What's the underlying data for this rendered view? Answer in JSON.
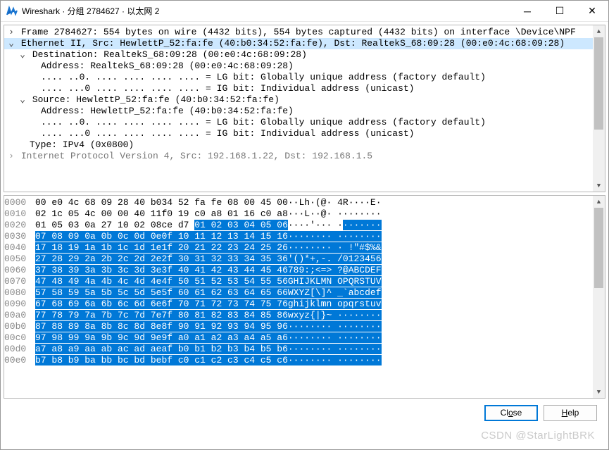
{
  "title": "Wireshark · 分组 2784627 · 以太网 2",
  "buttons": {
    "close": "Close",
    "help": "Help"
  },
  "watermark": "CSDN @StarLightBRK",
  "tree": {
    "frame": "Frame 2784627: 554 bytes on wire (4432 bits), 554 bytes captured (4432 bits) on interface \\Device\\NPF",
    "eth": "Ethernet II, Src: HewlettP_52:fa:fe (40:b0:34:52:fa:fe), Dst: RealtekS_68:09:28 (00:e0:4c:68:09:28)",
    "dest": "Destination: RealtekS_68:09:28 (00:e0:4c:68:09:28)",
    "dest_addr": "Address: RealtekS_68:09:28 (00:e0:4c:68:09:28)",
    "dest_lg": ".... ..0. .... .... .... .... = LG bit: Globally unique address (factory default)",
    "dest_ig": ".... ...0 .... .... .... .... = IG bit: Individual address (unicast)",
    "src": "Source: HewlettP_52:fa:fe (40:b0:34:52:fa:fe)",
    "src_addr": "Address: HewlettP_52:fa:fe (40:b0:34:52:fa:fe)",
    "src_lg": ".... ..0. .... .... .... .... = LG bit: Globally unique address (factory default)",
    "src_ig": ".... ...0 .... .... .... .... = IG bit: Individual address (unicast)",
    "type": "Type: IPv4 (0x0800)",
    "ip": "Internet Protocol Version 4, Src: 192.168.1.22, Dst: 192.168.1.5"
  },
  "hex": {
    "rows": [
      {
        "off": "0000",
        "h1": "00 e0 4c 68 09 28 40 b0",
        "h2": "34 52 fa fe 08 00 45 00",
        "a": "··Lh·(@· 4R····E·",
        "s1": 0,
        "s2": 0
      },
      {
        "off": "0010",
        "h1": "02 1c 05 4c 00 00 40 11",
        "h2": "f0 19 c0 a8 01 16 c0 a8",
        "a": "···L··@· ········",
        "s1": 0,
        "s2": 0
      },
      {
        "off": "0020",
        "h1": "01 05 03 0a 27 10 02 08",
        "h2": "ce d7 01 02 03 04 05 06",
        "a": "····'··· ········",
        "s1": 0,
        "s2": 30,
        "as": 10
      },
      {
        "off": "0030",
        "h1": "07 08 09 0a 0b 0c 0d 0e",
        "h2": "0f 10 11 12 13 14 15 16",
        "a": "········ ········",
        "s1": 1,
        "s2": 1,
        "as": 0
      },
      {
        "off": "0040",
        "h1": "17 18 19 1a 1b 1c 1d 1e",
        "h2": "1f 20 21 22 23 24 25 26",
        "a": "········ · !\"#$%&",
        "s1": 1,
        "s2": 1,
        "as": 0
      },
      {
        "off": "0050",
        "h1": "27 28 29 2a 2b 2c 2d 2e",
        "h2": "2f 30 31 32 33 34 35 36",
        "a": "'()*+,-. /0123456",
        "s1": 1,
        "s2": 1,
        "as": 0
      },
      {
        "off": "0060",
        "h1": "37 38 39 3a 3b 3c 3d 3e",
        "h2": "3f 40 41 42 43 44 45 46",
        "a": "789:;<=> ?@ABCDEF",
        "s1": 1,
        "s2": 1,
        "as": 0
      },
      {
        "off": "0070",
        "h1": "47 48 49 4a 4b 4c 4d 4e",
        "h2": "4f 50 51 52 53 54 55 56",
        "a": "GHIJKLMN OPQRSTUV",
        "s1": 1,
        "s2": 1,
        "as": 0
      },
      {
        "off": "0080",
        "h1": "57 58 59 5a 5b 5c 5d 5e",
        "h2": "5f 60 61 62 63 64 65 66",
        "a": "WXYZ[\\]^ _`abcdef",
        "s1": 1,
        "s2": 1,
        "as": 0
      },
      {
        "off": "0090",
        "h1": "67 68 69 6a 6b 6c 6d 6e",
        "h2": "6f 70 71 72 73 74 75 76",
        "a": "ghijklmn opqrstuv",
        "s1": 1,
        "s2": 1,
        "as": 0
      },
      {
        "off": "00a0",
        "h1": "77 78 79 7a 7b 7c 7d 7e",
        "h2": "7f 80 81 82 83 84 85 86",
        "a": "wxyz{|}~ ········",
        "s1": 1,
        "s2": 1,
        "as": 0
      },
      {
        "off": "00b0",
        "h1": "87 88 89 8a 8b 8c 8d 8e",
        "h2": "8f 90 91 92 93 94 95 96",
        "a": "········ ········",
        "s1": 1,
        "s2": 1,
        "as": 0
      },
      {
        "off": "00c0",
        "h1": "97 98 99 9a 9b 9c 9d 9e",
        "h2": "9f a0 a1 a2 a3 a4 a5 a6",
        "a": "········ ········",
        "s1": 1,
        "s2": 1,
        "as": 0
      },
      {
        "off": "00d0",
        "h1": "a7 a8 a9 aa ab ac ad ae",
        "h2": "af b0 b1 b2 b3 b4 b5 b6",
        "a": "········ ········",
        "s1": 1,
        "s2": 1,
        "as": 0
      },
      {
        "off": "00e0",
        "h1": "b7 b8 b9 ba bb bc bd be",
        "h2": "bf c0 c1 c2 c3 c4 c5 c6",
        "a": "········ ········",
        "s1": 1,
        "s2": 1,
        "as": 0
      }
    ]
  }
}
